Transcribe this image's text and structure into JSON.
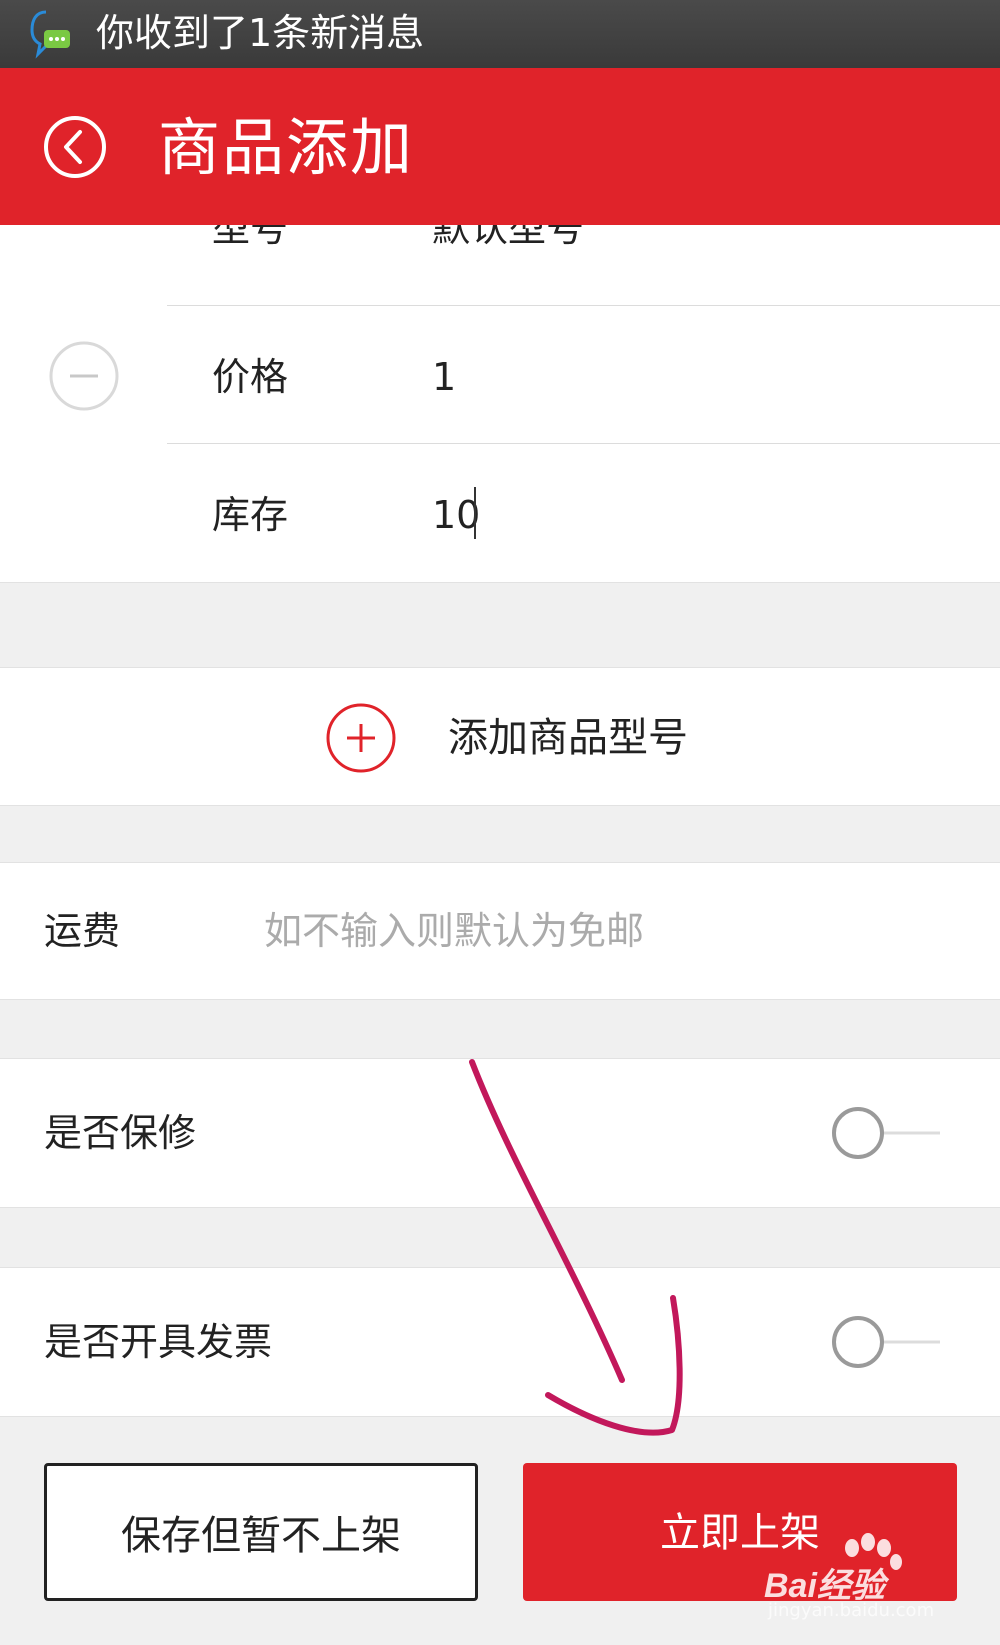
{
  "status_bar": {
    "notification": "你收到了1条新消息",
    "icon": "chat-notification-icon"
  },
  "header": {
    "title": "商品添加",
    "back_icon": "back-circle-icon"
  },
  "spec": {
    "model_label": "型号",
    "model_value": "默认型号",
    "price_label": "价格",
    "price_value": "1",
    "stock_label": "库存",
    "stock_value": "10",
    "remove_icon": "minus-circle-icon"
  },
  "add_model": {
    "label": "添加商品型号",
    "icon": "plus-circle-icon"
  },
  "shipping": {
    "label": "运费",
    "placeholder": "如不输入则默认为免邮",
    "value": ""
  },
  "warranty": {
    "label": "是否保修",
    "enabled": false
  },
  "invoice": {
    "label": "是否开具发票",
    "enabled": false
  },
  "buttons": {
    "save": "保存但暂不上架",
    "publish": "立即上架"
  },
  "watermark": {
    "brand": "Bai经验",
    "url": "jingyan.baidu.com"
  },
  "colors": {
    "brand_red": "#e0232a",
    "annotation": "#c2185b",
    "status_bar": "#3a3a3a"
  }
}
